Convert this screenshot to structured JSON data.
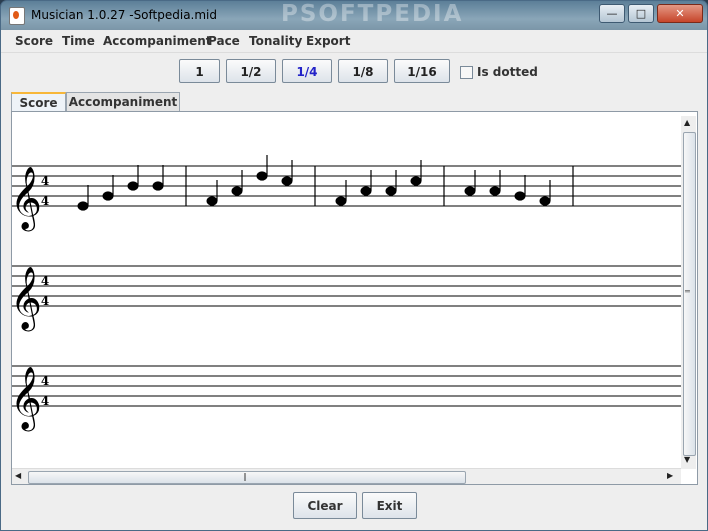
{
  "window": {
    "title": "Musician 1.0.27 -Softpedia.mid",
    "watermark": "PSOFTPEDIA"
  },
  "window_controls": {
    "minimize": "—",
    "maximize": "□",
    "close": "✕"
  },
  "menu": [
    "Score",
    "Time",
    "Accompaniment",
    "Pace",
    "Tonality",
    "Export"
  ],
  "durations": {
    "items": [
      "1",
      "1/2",
      "1/4",
      "1/8",
      "1/16"
    ],
    "selected": "1/4"
  },
  "dotted": {
    "label": "Is dotted",
    "checked": false
  },
  "tabs": [
    {
      "label": "Score",
      "active": true
    },
    {
      "label": "Accompaniment",
      "active": false
    }
  ],
  "staffs": [
    {
      "time_signature": {
        "top": "4",
        "bottom": "4"
      },
      "measures": [
        {
          "notes": [
            "E4",
            "G4",
            "B4",
            "B4"
          ]
        },
        {
          "notes": [
            "F4",
            "A4",
            "D5",
            "C5"
          ]
        },
        {
          "notes": [
            "F4",
            "A4",
            "A4",
            "C5"
          ]
        },
        {
          "notes": [
            "A4",
            "A4",
            "G4",
            "F4"
          ]
        }
      ]
    },
    {
      "time_signature": {
        "top": "4",
        "bottom": "4"
      },
      "measures": []
    },
    {
      "time_signature": {
        "top": "4",
        "bottom": "4"
      },
      "measures": []
    }
  ],
  "icons": {
    "clef": "treble-clef",
    "scroll_up": "arrow-up-icon",
    "scroll_down": "arrow-down-icon",
    "scroll_left": "arrow-left-icon",
    "scroll_right": "arrow-right-icon",
    "grip": "grip-icon"
  },
  "footer": {
    "clear_label": "Clear",
    "exit_label": "Exit"
  },
  "colors": {
    "selected_duration": "#2323c8",
    "active_tab_accent": "#f7b73a"
  }
}
